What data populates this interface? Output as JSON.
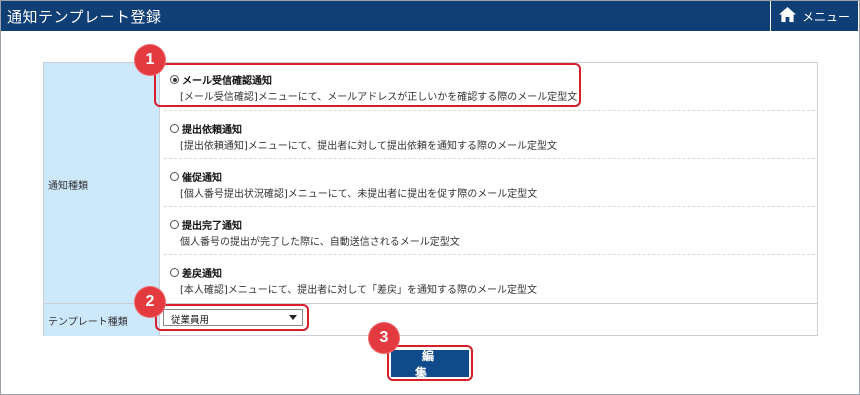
{
  "header": {
    "title": "通知テンプレート登録",
    "menu_label": "メニュー",
    "bg_color": "#0f3f75",
    "home_icon": "home-icon"
  },
  "form": {
    "kind_label": "通知種類",
    "template_kind_label": "テンプレート種類",
    "options": [
      {
        "title": "メール受信確認通知",
        "desc": "[メール受信確認]メニューにて、メールアドレスが正しいかを確認する際のメール定型文",
        "checked": true
      },
      {
        "title": "提出依頼通知",
        "desc": "[提出依頼通知]メニューにて、提出者に対して提出依頼を通知する際のメール定型文",
        "checked": false
      },
      {
        "title": "催促通知",
        "desc": "[個人番号提出状況確認]メニューにて、未提出者に提出を促す際のメール定型文",
        "checked": false
      },
      {
        "title": "提出完了通知",
        "desc": "個人番号の提出が完了した際に、自動送信されるメール定型文",
        "checked": false
      },
      {
        "title": "差戻通知",
        "desc": "[本人確認]メニューにて、提出者に対して「差戻」を通知する際のメール定型文",
        "checked": false
      }
    ],
    "template_select_value": "従業員用",
    "edit_button_label": "編集"
  },
  "callouts": [
    "1",
    "2",
    "3"
  ],
  "accent_colors": {
    "callout_red": "#e23a3f",
    "button_blue": "#0f4a8a",
    "label_bg": "#cde7fb"
  }
}
